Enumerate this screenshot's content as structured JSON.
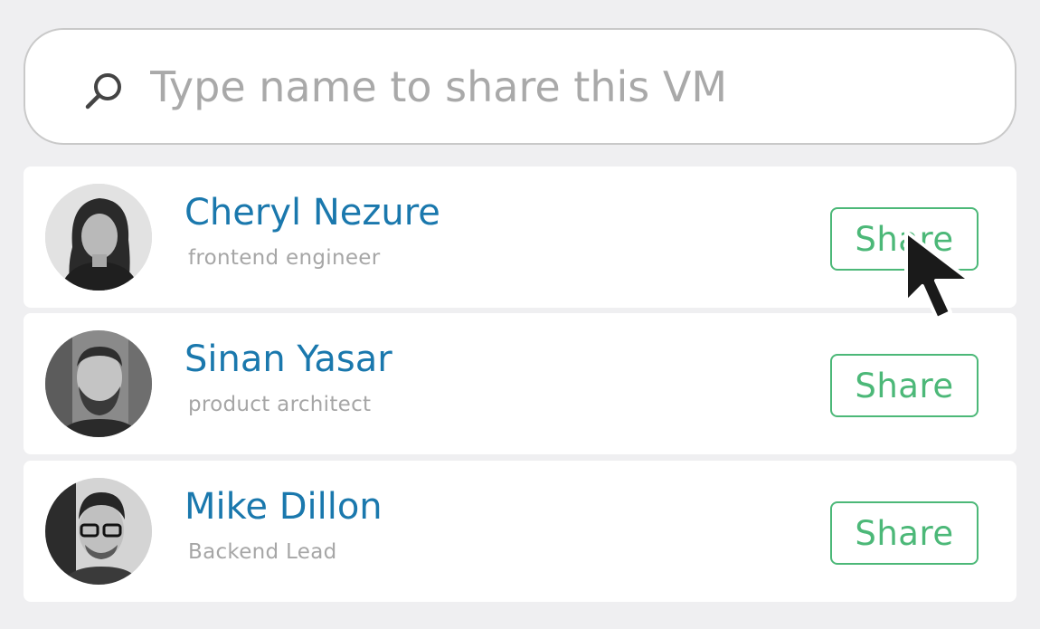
{
  "search": {
    "placeholder": "Type name to share this VM",
    "icon": "search-icon"
  },
  "users": [
    {
      "name": "Cheryl Nezure",
      "role": "frontend engineer",
      "share_label": "Share",
      "avatar": "avatar-photo"
    },
    {
      "name": "Sinan Yasar",
      "role": "product architect",
      "share_label": "Share",
      "avatar": "avatar-photo"
    },
    {
      "name": "Mike Dillon",
      "role": "Backend Lead",
      "share_label": "Share",
      "avatar": "avatar-photo"
    }
  ],
  "colors": {
    "name": "#1a78ad",
    "share": "#4cb878",
    "background": "#efeff1"
  },
  "cursor": {
    "icon": "mouse-pointer-icon"
  }
}
